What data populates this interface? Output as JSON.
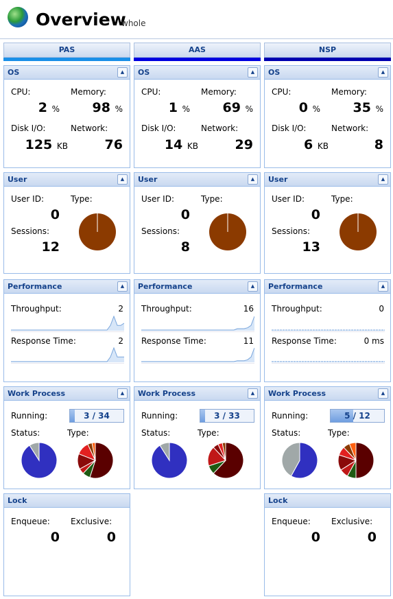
{
  "header": {
    "title": "Overview",
    "subtitle": "whole",
    "icon": "globe-icon"
  },
  "labels": {
    "os": "OS",
    "user": "User",
    "performance": "Performance",
    "work_process": "Work Process",
    "lock": "Lock",
    "cpu": "CPU:",
    "memory": "Memory:",
    "disk": "Disk I/O:",
    "network": "Network:",
    "user_id": "User ID:",
    "type": "Type:",
    "sessions": "Sessions:",
    "throughput": "Throughput:",
    "response": "Response Time:",
    "running": "Running:",
    "status": "Status:",
    "enqueue": "Enqueue:",
    "exclusive": "Exclusive:",
    "pct": "%",
    "kb": "KB"
  },
  "colors": {
    "PAS": "#1a8fe8",
    "AAS": "#0000e0",
    "NSP": "#0000b0",
    "user_type": "#8b3a00",
    "status_running": "#3030c0",
    "status_idle": "#a0a8a8"
  },
  "columns": [
    {
      "name": "PAS",
      "cpu": "2",
      "memory": "98",
      "disk": "125",
      "network": "76",
      "user_id": "0",
      "sessions": "12",
      "user_type_pie": [
        1
      ],
      "throughput": "2",
      "response": "2",
      "tp_series": [
        0,
        0,
        0,
        0,
        0,
        0,
        0,
        0,
        0,
        0,
        0,
        0,
        0,
        0,
        0,
        0,
        0,
        0,
        0,
        0,
        0,
        0,
        0,
        0,
        0,
        0,
        0,
        0,
        0,
        1,
        3,
        1,
        1,
        1.5
      ],
      "rt_series": [
        0,
        0,
        0,
        0,
        0,
        0,
        0,
        0,
        0,
        0,
        0,
        0,
        0,
        0,
        0,
        0,
        0,
        0,
        0,
        0,
        0,
        0,
        0,
        0,
        0,
        0,
        0,
        0,
        0,
        1,
        3,
        1,
        1,
        1
      ],
      "running": "3 / 34",
      "running_frac": 0.09,
      "status_pie": [
        0.91,
        0.09
      ],
      "type_pie": [
        0.55,
        0.07,
        0.05,
        0.14,
        0.12,
        0.04,
        0.03
      ],
      "lock": {
        "enqueue": "0",
        "exclusive": "0"
      }
    },
    {
      "name": "AAS",
      "cpu": "1",
      "memory": "69",
      "disk": "14",
      "network": "29",
      "user_id": "0",
      "sessions": "8",
      "user_type_pie": [
        1
      ],
      "throughput": "16",
      "response": "11",
      "tp_series": [
        0,
        0,
        0,
        0,
        0,
        0,
        0,
        0,
        0,
        0,
        0,
        0,
        0,
        0,
        0,
        0,
        0,
        0,
        0,
        0,
        0,
        0,
        0,
        0,
        0,
        0,
        0,
        0,
        0.3,
        0.3,
        0.3,
        0.5,
        1,
        3
      ],
      "rt_series": [
        0,
        0,
        0,
        0,
        0,
        0,
        0,
        0,
        0,
        0,
        0,
        0,
        0,
        0,
        0,
        0,
        0,
        0,
        0,
        0,
        0,
        0,
        0,
        0,
        0,
        0,
        0,
        0,
        0.2,
        0.2,
        0.2,
        0.4,
        1,
        3
      ],
      "running": "3 / 33",
      "running_frac": 0.09,
      "status_pie": [
        0.91,
        0.09
      ],
      "type_pie": [
        0.62,
        0.08,
        0.18,
        0.05,
        0.04,
        0.03
      ],
      "lock": null
    },
    {
      "name": "NSP",
      "cpu": "0",
      "memory": "35",
      "disk": "6",
      "network": "8",
      "user_id": "0",
      "sessions": "13",
      "user_type_pie": [
        1
      ],
      "throughput": "0",
      "response": "0 ms",
      "tp_series": [
        0,
        0
      ],
      "rt_series": [
        0,
        0
      ],
      "running": "5 / 12",
      "running_frac": 0.42,
      "status_pie": [
        0.58,
        0.42
      ],
      "type_pie": [
        0.5,
        0.08,
        0.08,
        0.14,
        0.08,
        0.06,
        0.06
      ],
      "lock": {
        "enqueue": "0",
        "exclusive": "0"
      }
    }
  ]
}
